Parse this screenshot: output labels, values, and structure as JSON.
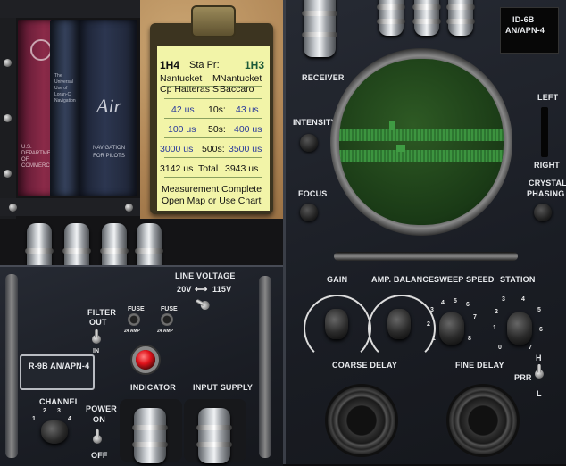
{
  "clipboard": {
    "header_left": "1H4",
    "header_mid": "Sta Pr:",
    "header_right": "1H3",
    "stations_row1_left": "Nantucket",
    "stations_row1_mark": "M",
    "stations_row1_right": "Nantucket",
    "stations_row2_left": "Cp Hatteras",
    "stations_row2_mark": "S",
    "stations_row2_right": "Baccaro",
    "row1_a": "42 us",
    "row1_b": "10s:",
    "row1_c": "43 us",
    "row2_a": "100 us",
    "row2_b": "50s:",
    "row2_c": "400 us",
    "row3_a": "3000 us",
    "row3_b": "500s:",
    "row3_c": "3500 us",
    "total_a": "3142 us",
    "total_b": "Total",
    "total_c": "3943 us",
    "status_line1": "Measurement Complete",
    "status_line2": "Open Map or Use Chart"
  },
  "books": {
    "book1_lines": [
      "U.S.",
      "DEPARTMENT",
      "OF",
      "COMMERCE"
    ],
    "book2_text": "The Universal Use of Loran-C Navigation",
    "book3_logo": "Air",
    "book3_title": "NAVIGATION FOR PILOTS"
  },
  "receiver": {
    "model_line1": "R-9B AN/APN-4",
    "line_voltage_label": "LINE VOLTAGE",
    "voltage_low": "20V",
    "voltage_high": "115V",
    "filter_label_1": "FILTER",
    "filter_label_2": "OUT",
    "filter_in": "IN",
    "fuse_label": "FUSE",
    "fuse_rating": "24 AMP",
    "indicator_label": "INDICATOR",
    "input_supply_label": "INPUT SUPPLY",
    "channel_label": "CHANNEL",
    "channel_numbers": [
      "1",
      "2",
      "3",
      "4"
    ],
    "power_label": "POWER",
    "power_on": "ON",
    "power_off": "OFF"
  },
  "indicator": {
    "plate_line1": "ID-6B",
    "plate_line2": "AN/APN-4",
    "receiver_label": "RECEIVER",
    "intensity_label": "INTENSITY",
    "focus_label": "FOCUS",
    "left_label": "LEFT",
    "right_label": "RIGHT",
    "crystal_label_1": "CRYSTAL",
    "crystal_label_2": "PHASING",
    "gain_label": "GAIN",
    "amp_balance_label": "AMP. BALANCE",
    "sweep_speed_label": "SWEEP SPEED",
    "station_label": "STATION",
    "sweep_numbers": [
      "1",
      "2",
      "3",
      "4",
      "5",
      "6",
      "7",
      "8"
    ],
    "station_numbers": [
      "0",
      "1",
      "2",
      "3",
      "4",
      "5",
      "6",
      "7"
    ],
    "coarse_delay_label": "COARSE DELAY",
    "fine_delay_label": "FINE DELAY",
    "prr_label": "PRR",
    "prr_h": "H",
    "prr_l": "L"
  },
  "colors": {
    "screen_green": "#3f9c43",
    "screen_bg": "#1a3a16",
    "clipboard_paper": "#f2f4a8",
    "indicator_lamp": "#e0121a"
  }
}
